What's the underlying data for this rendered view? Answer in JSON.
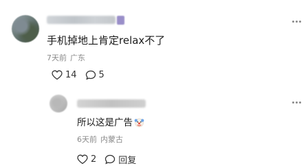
{
  "main_comment": {
    "text": "手机掉地上肯定relax不了",
    "time": "7天前",
    "location": "广东",
    "like_count": "14",
    "reply_count": "5"
  },
  "reply_comment": {
    "text": "所以这是广告",
    "emoji": "clown-face-icon",
    "time": "6天前",
    "location": "内蒙古",
    "like_count": "2",
    "reply_count": "0",
    "reply_label": "回复"
  },
  "colors": {
    "meta_text": "#8a8a8a",
    "body_text": "#1a1a1a"
  }
}
